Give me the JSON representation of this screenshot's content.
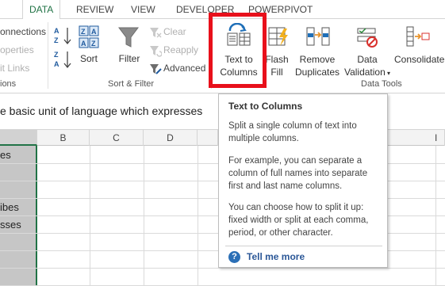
{
  "tabs": {
    "data": "DATA",
    "review": "REVIEW",
    "view": "VIEW",
    "developer": "DEVELOPER",
    "powerpivot": "POWERPIVOT"
  },
  "connections": {
    "connections": "onnections",
    "properties": "operties",
    "edit_links": "it Links",
    "group_label": "ions"
  },
  "sort_filter": {
    "sort": "Sort",
    "filter": "Filter",
    "clear": "Clear",
    "reapply": "Reapply",
    "advanced": "Advanced",
    "group_label": "Sort & Filter"
  },
  "data_tools": {
    "text_to_columns_line1": "Text to",
    "text_to_columns_line2": "Columns",
    "flash_fill_line1": "Flash",
    "flash_fill_line2": "Fill",
    "remove_dup_line1": "Remove",
    "remove_dup_line2": "Duplicates",
    "validation_line1": "Data",
    "validation_line2": "Validation",
    "consolidate": "Consolidate",
    "group_label": "Data Tools"
  },
  "formula_bar": {
    "content": "e basic unit of language which expresses"
  },
  "columns": {
    "a": "",
    "b": "B",
    "c": "C",
    "d": "D",
    "i": "I"
  },
  "cells": {
    "row1": "es",
    "row4": "ibes",
    "row5": "sses"
  },
  "tooltip": {
    "title": "Text to Columns",
    "p1": "Split a single column of text into multiple columns.",
    "p2": "For example, you can separate a column of full names into separate first and last name columns.",
    "p3": "You can choose how to split it up: fixed width or split at each comma, period, or other character.",
    "help_link": "Tell me more",
    "help_icon": "?"
  },
  "colors": {
    "accent": "#217346",
    "highlight": "#e8101b",
    "link": "#2b5797"
  }
}
